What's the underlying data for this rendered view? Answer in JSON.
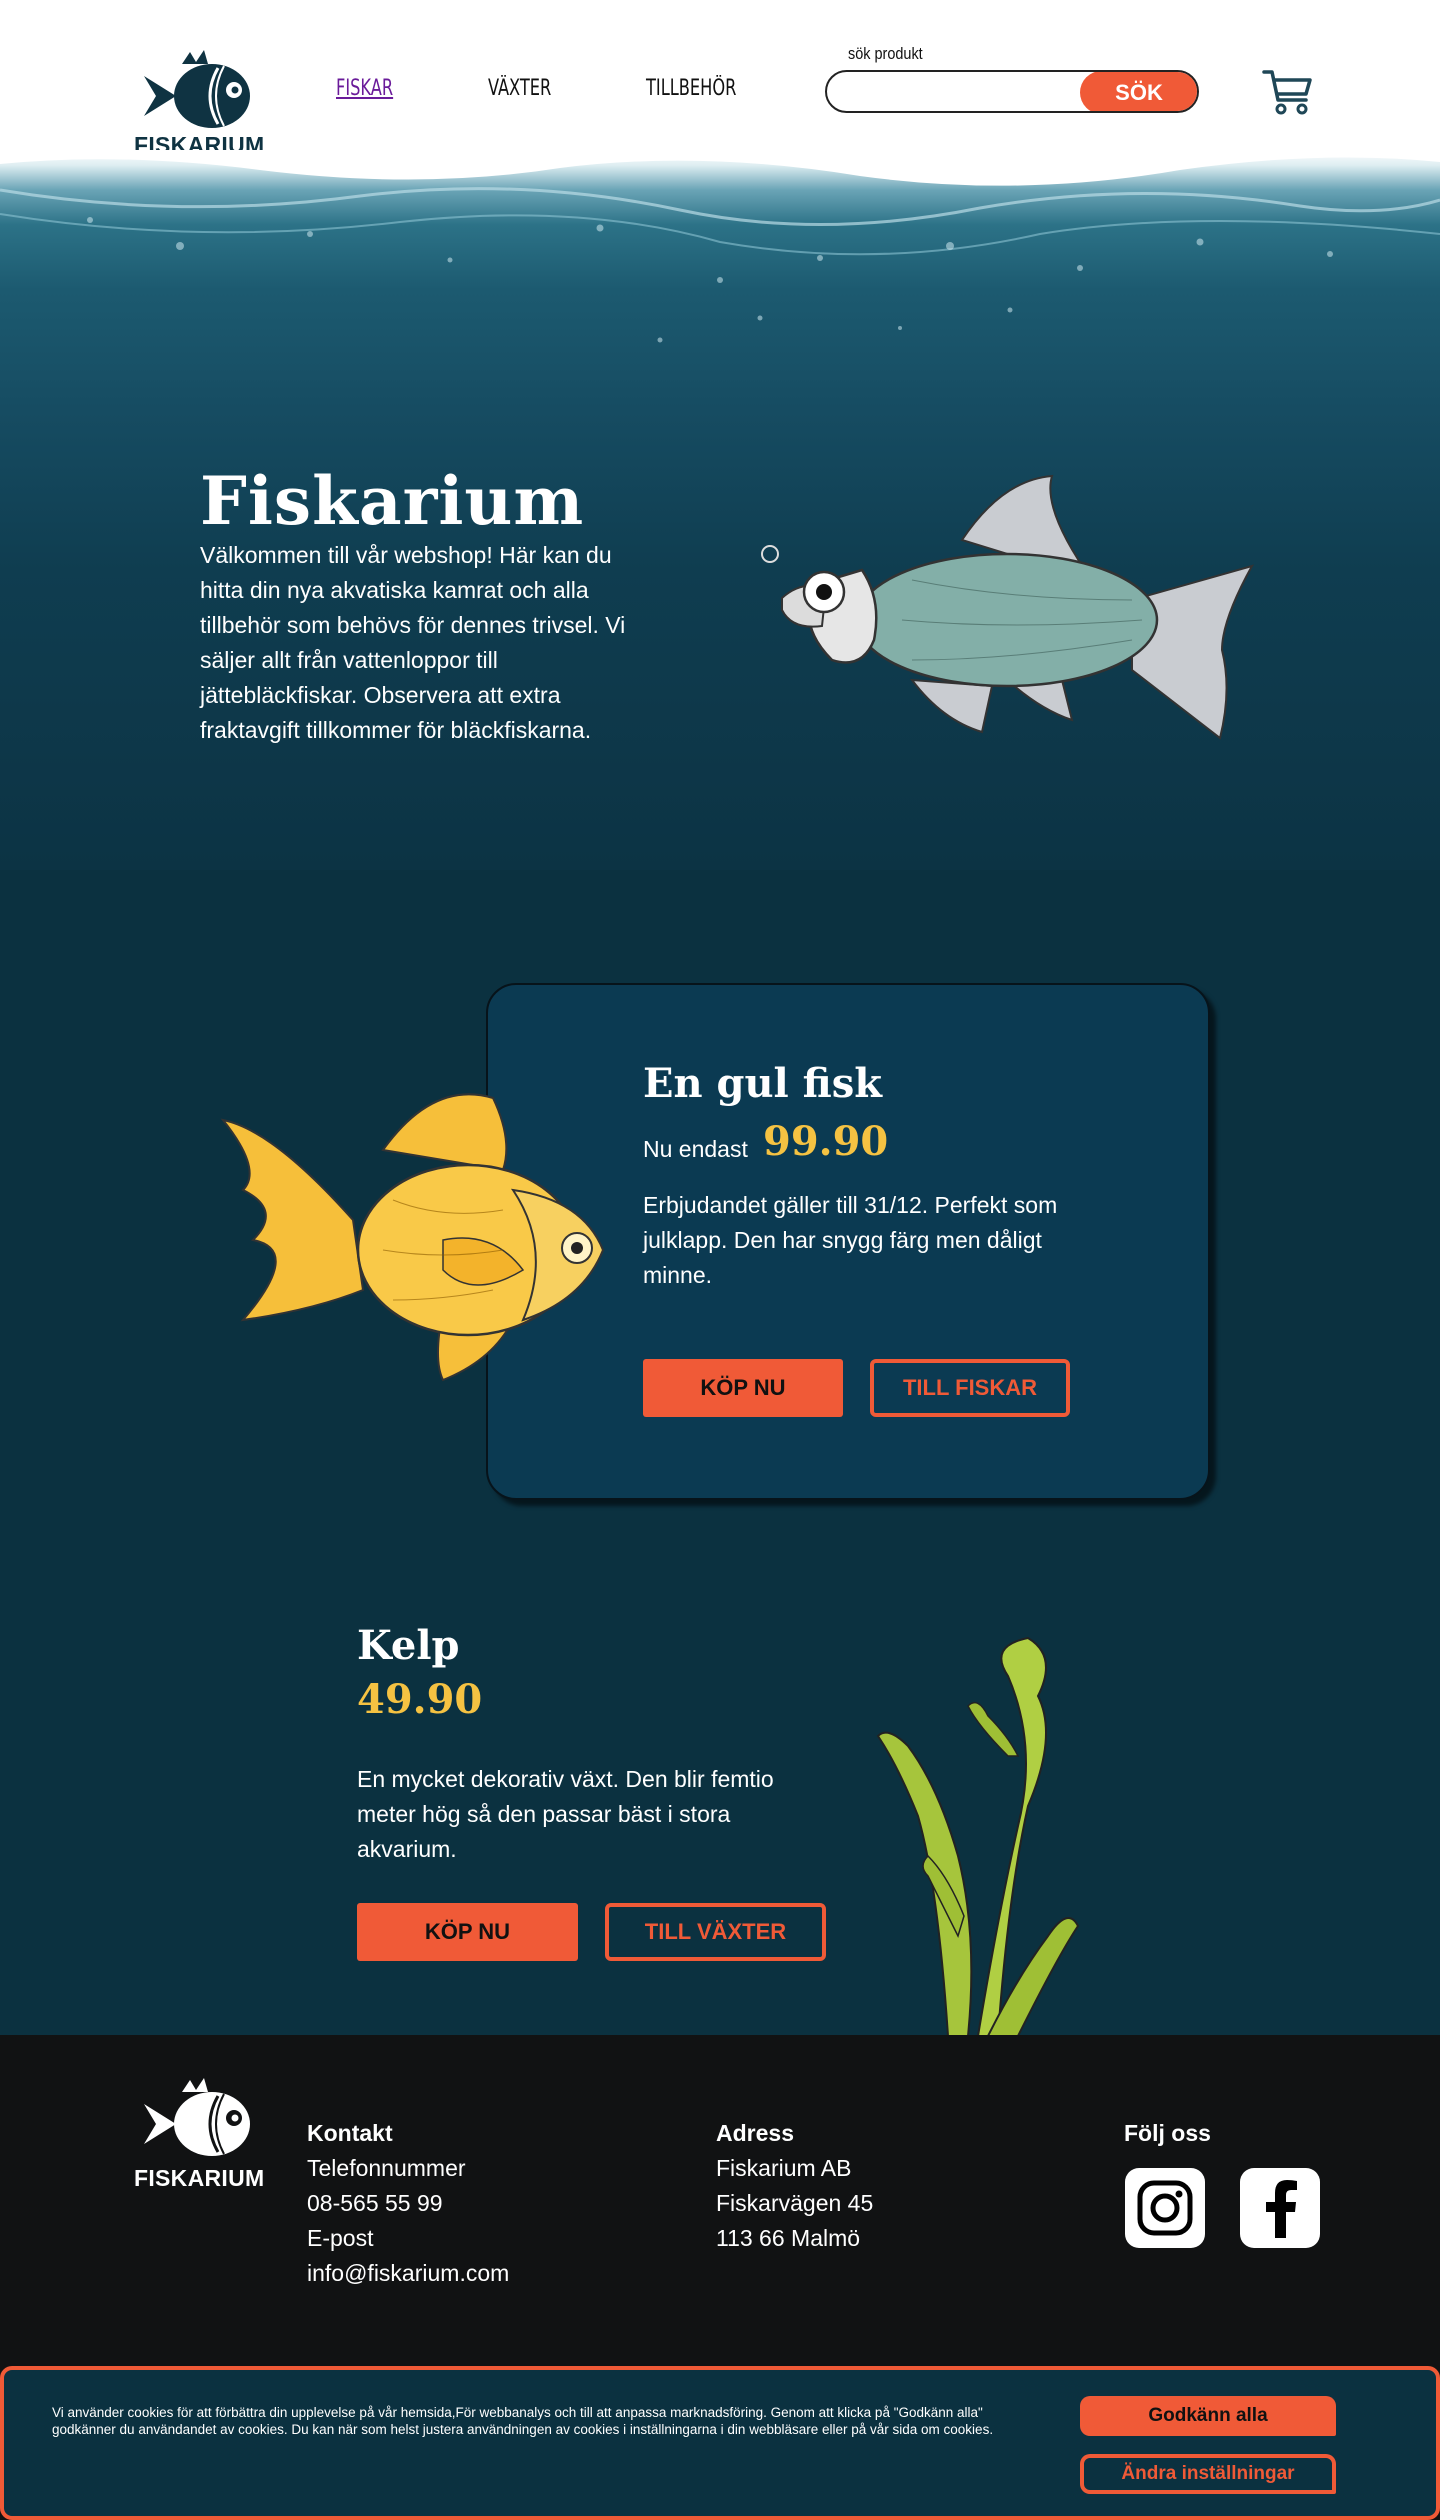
{
  "brand": {
    "name": "FISKARIUM"
  },
  "nav": {
    "items": [
      {
        "label": "FISKAR",
        "active": true
      },
      {
        "label": "VÄXTER",
        "active": false
      },
      {
        "label": "TILLBEHÖR",
        "active": false
      }
    ]
  },
  "search": {
    "label": "sök produkt",
    "value": "",
    "placeholder": "",
    "button": "SÖK"
  },
  "hero": {
    "title": "Fiskarium",
    "text": "Välkommen till vår webshop! Här kan du hitta din nya akvatiska kamrat och alla tillbehör som behövs för dennes trivsel. Vi säljer allt från vattenloppor till jättebläckfiskar. Observera att extra fraktavgift tillkommer för bläckfiskarna."
  },
  "offer": {
    "title": "En gul fisk",
    "price_prefix": "Nu endast",
    "price": "99.90",
    "text": "Erbjudandet gäller till 31/12. Perfekt som julklapp. Den har snygg färg men dåligt minne.",
    "buy_button": "KÖP NU",
    "more_button": "TILL FISKAR"
  },
  "kelp": {
    "title": "Kelp",
    "price": "49.90",
    "text": "En mycket dekorativ växt. Den blir femtio meter hög så den passar bäst i stora akvarium.",
    "buy_button": "KÖP NU",
    "more_button": "TILL VÄXTER"
  },
  "footer": {
    "contact": {
      "heading": "Kontakt",
      "phone_label": "Telefonnummer",
      "phone": "08-565 55 99",
      "email_label": "E-post",
      "email": "info@fiskarium.com"
    },
    "address": {
      "heading": "Adress",
      "line1": "Fiskarium AB",
      "line2": "Fiskarvägen 45",
      "line3": "113 66 Malmö"
    },
    "social": {
      "heading": "Följ oss",
      "icons": [
        "instagram-icon",
        "facebook-icon"
      ]
    }
  },
  "cookie": {
    "text": "Vi använder cookies för att förbättra din upplevelse på vår hemsida,För webbanalys och till att anpassa marknadsföring. Genom att klicka på \"Godkänn alla\" godkänner du användandet av cookies. Du kan när som helst justera användningen av cookies i inställningarna i din webbläsare eller på vår sida om cookies.",
    "accept_button": "Godkänn alla",
    "settings_button": "Ändra inställningar"
  },
  "colors": {
    "accent": "#f05a37",
    "price": "#f5c242",
    "navy": "#0b3140",
    "footer": "#111213",
    "active_nav": "#6a1b9a"
  }
}
